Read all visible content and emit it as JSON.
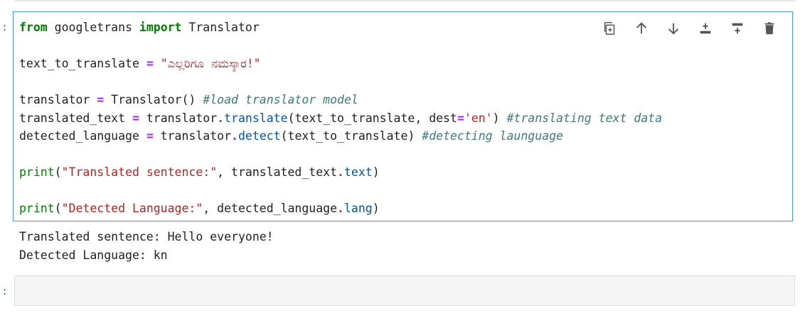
{
  "cell": {
    "prompt": ":",
    "code_lines": [
      [
        {
          "t": "from",
          "c": "kw"
        },
        {
          "t": " googletrans ",
          "c": ""
        },
        {
          "t": "import",
          "c": "kw"
        },
        {
          "t": " Translator",
          "c": ""
        }
      ],
      [],
      [
        {
          "t": "text_to_translate ",
          "c": ""
        },
        {
          "t": "=",
          "c": "op"
        },
        {
          "t": " ",
          "c": ""
        },
        {
          "t": "\"ಎಲ್ಲರಿಗೂ ನಮಸ್ಕಾರ!\"",
          "c": "str"
        }
      ],
      [],
      [
        {
          "t": "translator ",
          "c": ""
        },
        {
          "t": "=",
          "c": "op"
        },
        {
          "t": " Translator() ",
          "c": ""
        },
        {
          "t": "#load translator model",
          "c": "cmt"
        }
      ],
      [
        {
          "t": "translated_text ",
          "c": ""
        },
        {
          "t": "=",
          "c": "op"
        },
        {
          "t": " translator",
          "c": ""
        },
        {
          "t": ".",
          "c": "op"
        },
        {
          "t": "translate",
          "c": "attr"
        },
        {
          "t": "(text_to_translate, dest",
          "c": ""
        },
        {
          "t": "=",
          "c": "op"
        },
        {
          "t": "'en'",
          "c": "str"
        },
        {
          "t": ") ",
          "c": ""
        },
        {
          "t": "#translating text data",
          "c": "cmt"
        }
      ],
      [
        {
          "t": "detected_language ",
          "c": ""
        },
        {
          "t": "=",
          "c": "op"
        },
        {
          "t": " translator",
          "c": ""
        },
        {
          "t": ".",
          "c": "op"
        },
        {
          "t": "detect",
          "c": "attr"
        },
        {
          "t": "(text_to_translate) ",
          "c": ""
        },
        {
          "t": "#detecting launguage",
          "c": "cmt"
        }
      ],
      [],
      [
        {
          "t": "print",
          "c": "bi"
        },
        {
          "t": "(",
          "c": ""
        },
        {
          "t": "\"Translated sentence:\"",
          "c": "str"
        },
        {
          "t": ", translated_text",
          "c": ""
        },
        {
          "t": ".",
          "c": "op"
        },
        {
          "t": "text",
          "c": "attr"
        },
        {
          "t": ")",
          "c": ""
        }
      ],
      [],
      [
        {
          "t": "print",
          "c": "bi"
        },
        {
          "t": "(",
          "c": ""
        },
        {
          "t": "\"Detected Language:\"",
          "c": "str"
        },
        {
          "t": ", detected_language",
          "c": ""
        },
        {
          "t": ".",
          "c": "op"
        },
        {
          "t": "lang",
          "c": "attr"
        },
        {
          "t": ")",
          "c": ""
        }
      ]
    ]
  },
  "toolbar": [
    {
      "name": "duplicate-cell-icon"
    },
    {
      "name": "move-up-icon"
    },
    {
      "name": "move-down-icon"
    },
    {
      "name": "insert-above-icon"
    },
    {
      "name": "insert-below-icon"
    },
    {
      "name": "delete-cell-icon"
    }
  ],
  "output": {
    "lines": [
      "Translated sentence: Hello everyone!",
      "Detected Language: kn"
    ]
  },
  "empty_cell": {
    "prompt": ":"
  },
  "colors": {
    "accent": "#4a90e2",
    "keyword": "#008000",
    "operator": "#aa22ff",
    "string": "#ba2121",
    "comment": "#3d7b7b",
    "attribute": "#0055aa"
  }
}
